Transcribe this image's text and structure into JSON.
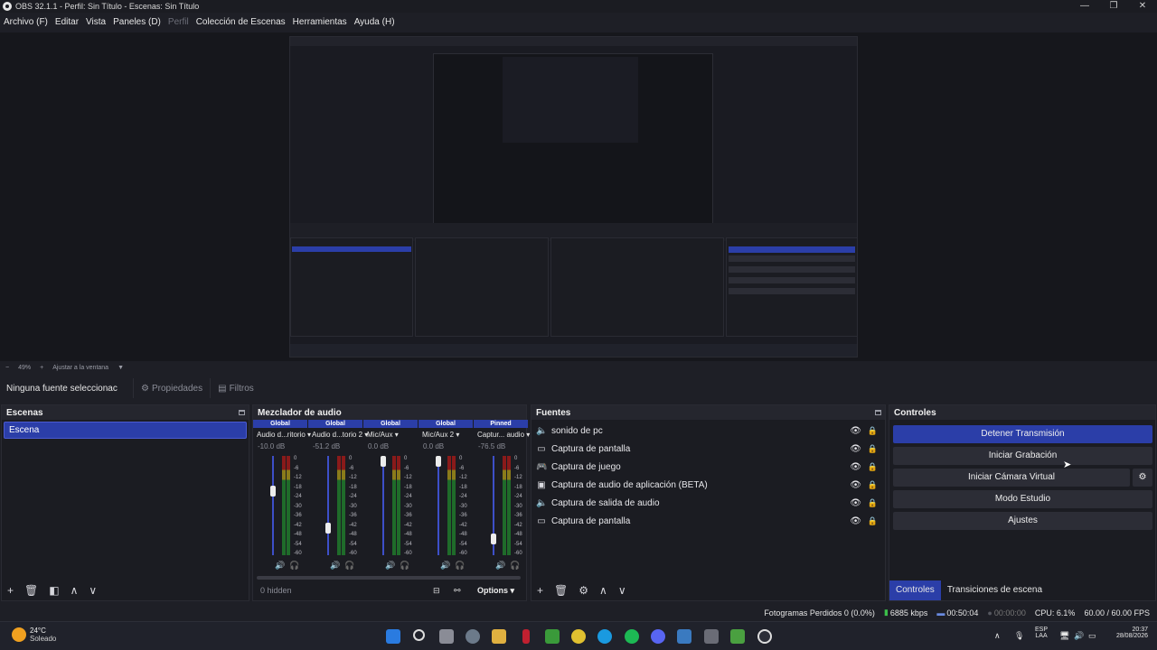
{
  "window": {
    "title": "OBS 32.1.1 - Perfil: Sin Título - Escenas: Sin Título"
  },
  "menu": [
    {
      "label": "Archivo (F)"
    },
    {
      "label": "Editar"
    },
    {
      "label": "Vista"
    },
    {
      "label": "Paneles (D)"
    },
    {
      "label": "Perfil",
      "disabled": true
    },
    {
      "label": "Colección de Escenas"
    },
    {
      "label": "Herramientas"
    },
    {
      "label": "Ayuda (H)"
    }
  ],
  "zoom": {
    "percent": "49%",
    "fit_label": "Ajustar a la ventana"
  },
  "source_toolbar": {
    "no_source": "Ninguna fuente seleccionac",
    "properties": "Propiedades",
    "filters": "Filtros"
  },
  "scenes": {
    "title": "Escenas",
    "items": [
      "Escena"
    ]
  },
  "mixer": {
    "title": "Mezclador de audio",
    "channels": [
      {
        "group": "Global",
        "name": "Audio d...ritorio",
        "db": "-10.0 dB",
        "level": 0.66
      },
      {
        "group": "Global",
        "name": "Audio d...torio 2",
        "db": "-51.2 dB",
        "level": 0.25
      },
      {
        "group": "Global",
        "name": "Mic/Aux",
        "db": "0.0 dB",
        "level": 1.0
      },
      {
        "group": "Global",
        "name": "Mic/Aux 2",
        "db": "0.0 dB",
        "level": 1.0
      },
      {
        "group": "Pinned",
        "name": "Captur... audio",
        "db": "-76.5 dB",
        "level": 0.12
      }
    ],
    "scale": [
      "0",
      "-6",
      "-12",
      "-18",
      "-24",
      "-30",
      "-36",
      "-42",
      "-48",
      "-54",
      "-60"
    ],
    "hidden": "0 hidden",
    "options": "Options"
  },
  "sources": {
    "title": "Fuentes",
    "items": [
      {
        "icon": "speaker-icon",
        "name": "sonido de pc"
      },
      {
        "icon": "monitor-icon",
        "name": "Captura de pantalla"
      },
      {
        "icon": "gamepad-icon",
        "name": "Captura de juego"
      },
      {
        "icon": "app-audio-icon",
        "name": "Captura de audio de aplicación (BETA)"
      },
      {
        "icon": "speaker-icon",
        "name": "Captura de salida de audio"
      },
      {
        "icon": "monitor-icon",
        "name": "Captura de pantalla"
      }
    ]
  },
  "controls": {
    "title": "Controles",
    "stop_stream": "Detener Transmisión",
    "start_recording": "Iniciar Grabación",
    "start_virtualcam": "Iniciar Cámara Virtual",
    "studio_mode": "Modo Estudio",
    "settings": "Ajustes",
    "tab_controls": "Controles",
    "tab_transitions": "Transiciones de escena"
  },
  "status": {
    "dropped": "Fotogramas Perdidos 0 (0.0%)",
    "bitrate": "6885 kbps",
    "stream_time": "00:50:04",
    "rec_time": "00:00:00",
    "cpu": "CPU: 6.1%",
    "fps": "60.00 / 60.00 FPS"
  },
  "taskbar": {
    "weather_temp": "24°C",
    "weather_desc": "Soleado",
    "lang1": "ESP",
    "lang2": "LAA",
    "time": "20:37",
    "date": "28/08/2026"
  },
  "colors": {
    "accent": "#2b3ea8",
    "background": "#1e1f26"
  }
}
